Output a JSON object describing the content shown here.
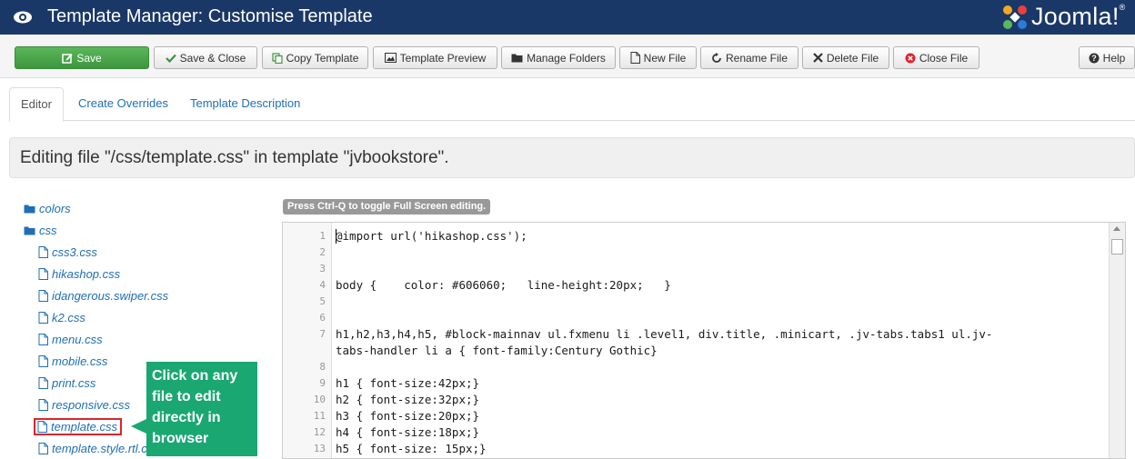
{
  "header": {
    "title": "Template Manager: Customise Template",
    "logo_text": "Joomla!",
    "logo_reg": "®"
  },
  "toolbar": {
    "buttons": [
      {
        "label": "Save",
        "icon": "edit-icon"
      },
      {
        "label": "Save & Close",
        "icon": "check-icon"
      },
      {
        "label": "Copy Template",
        "icon": "copy-icon"
      },
      {
        "label": "Template Preview",
        "icon": "picture-icon"
      },
      {
        "label": "Manage Folders",
        "icon": "folder-icon"
      },
      {
        "label": "New File",
        "icon": "file-icon"
      },
      {
        "label": "Rename File",
        "icon": "refresh-icon"
      },
      {
        "label": "Delete File",
        "icon": "remove-icon"
      },
      {
        "label": "Close File",
        "icon": "cancel-icon"
      },
      {
        "label": "Help",
        "icon": "question-icon"
      }
    ]
  },
  "tabs": [
    {
      "label": "Editor",
      "active": true
    },
    {
      "label": "Create Overrides",
      "active": false
    },
    {
      "label": "Template Description",
      "active": false
    }
  ],
  "banner": {
    "text": "Editing file \"/css/template.css\" in template \"jvbookstore\"."
  },
  "tree": {
    "folders": [
      "colors",
      "css"
    ],
    "files": [
      "css3.css",
      "hikashop.css",
      "idangerous.swiper.css",
      "k2.css",
      "menu.css",
      "mobile.css",
      "print.css",
      "responsive.css",
      "template.css",
      "template.style.rtl.c"
    ],
    "selected": "template.css"
  },
  "callout": {
    "text": "Click on any file to edit directly in browser",
    "lines": [
      "Click on any",
      "file to edit",
      "directly in",
      "browser"
    ]
  },
  "editor": {
    "hint": "Press Ctrl-Q to toggle Full Screen editing.",
    "line_numbers": [
      "1",
      "2",
      "3",
      "4",
      "5",
      "6",
      "7",
      "8",
      "9",
      "10",
      "11",
      "12",
      "13"
    ],
    "code": {
      "l1": "@import url('hikashop.css');",
      "l4": "body {    color: #606060;   line-height:20px;   }",
      "l7a": "h1,h2,h3,h4,h5, #block-mainnav ul.fxmenu li .level1, div.title, .minicart, .jv-tabs.tabs1 ul.jv-",
      "l7b": "tabs-handler li a { font-family:Century Gothic}",
      "l9": "h1 { font-size:42px;}",
      "l10": "h2 { font-size:32px;}",
      "l11": "h3 { font-size:20px;}",
      "l12": "h4 { font-size:18px;}",
      "l13": "h5 { font-size: 15px;}"
    }
  },
  "colors": {
    "header_bg": "#1a3867",
    "save_green": "#5bb75b",
    "link_blue": "#1f6fb5",
    "callout_green": "#1aa772",
    "selected_border": "#d9262c"
  }
}
